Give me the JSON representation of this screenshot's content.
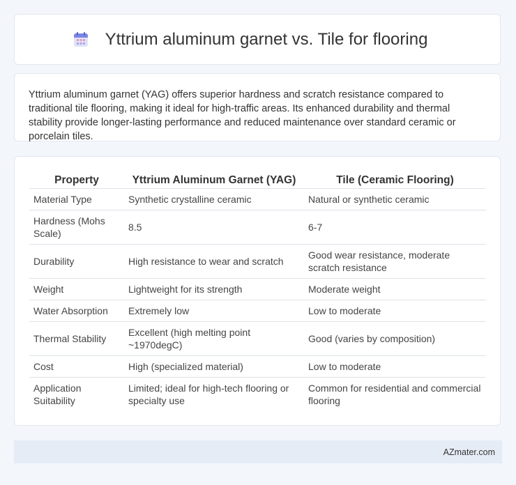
{
  "header": {
    "title": "Yttrium aluminum garnet vs. Tile for flooring",
    "icon": "calendar-icon"
  },
  "intro": {
    "text": "Yttrium aluminum garnet (YAG) offers superior hardness and scratch resistance compared to traditional tile flooring, making it ideal for high-traffic areas. Its enhanced durability and thermal stability provide longer-lasting performance and reduced maintenance over standard ceramic or porcelain tiles."
  },
  "table": {
    "headers": [
      "Property",
      "Yttrium Aluminum Garnet (YAG)",
      "Tile (Ceramic Flooring)"
    ],
    "rows": [
      [
        "Material Type",
        "Synthetic crystalline ceramic",
        "Natural or synthetic ceramic"
      ],
      [
        "Hardness (Mohs Scale)",
        "8.5",
        "6-7"
      ],
      [
        "Durability",
        "High resistance to wear and scratch",
        "Good wear resistance, moderate scratch resistance"
      ],
      [
        "Weight",
        "Lightweight for its strength",
        "Moderate weight"
      ],
      [
        "Water Absorption",
        "Extremely low",
        "Low to moderate"
      ],
      [
        "Thermal Stability",
        "Excellent (high melting point ~1970degC)",
        "Good (varies by composition)"
      ],
      [
        "Cost",
        "High (specialized material)",
        "Low to moderate"
      ],
      [
        "Application Suitability",
        "Limited; ideal for high-tech flooring or specialty use",
        "Common for residential and commercial flooring"
      ]
    ]
  },
  "footer": {
    "brand": "AZmater.com"
  }
}
